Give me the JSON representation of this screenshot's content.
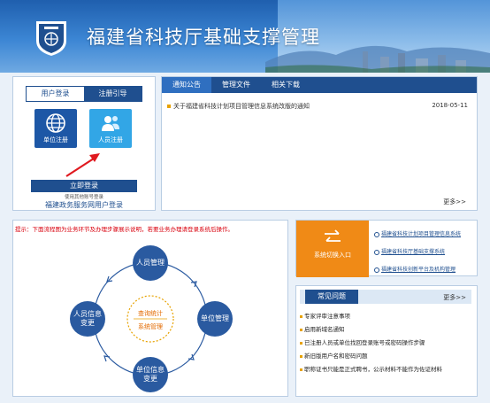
{
  "header": {
    "title": "福建省科技厅基础支撑管理"
  },
  "login": {
    "tabs": [
      "用户登录",
      "注册引导"
    ],
    "unit_register": "单位注册",
    "person_register": "人员注册",
    "login_button": "立即登录",
    "note": "使用其他账号登录",
    "gov_link": "福建政务服务网用户登录"
  },
  "notice": {
    "tabs": [
      "通知公告",
      "管理文件",
      "相关下载"
    ],
    "items": [
      {
        "title": "关于福建省科技计划项目管理信息系统改版的通知",
        "date": "2018-05-11"
      }
    ],
    "more": "更多>>"
  },
  "process": {
    "hint": "提示：下面流程图为业务环节及办理步骤展示说明，若要业务办理请登录系统后操作。",
    "nodes": {
      "top": "人员管理",
      "right": "单位管理",
      "bottom": "单位信息变更",
      "left": "人员信息变更"
    },
    "center": [
      "查询统计",
      "系统管理"
    ]
  },
  "switch": {
    "label": "系统切换入口",
    "links": [
      "福建省科技计划项目管理信息系统",
      "福建省科技厅基础支撑系统",
      "福建省科技创新平台及机构管理"
    ]
  },
  "faq": {
    "title": "常见问题",
    "more": "更多>>",
    "items": [
      "专家评审注意事项",
      "启用新域名通知",
      "已注册人员或单位找回登录账号或密码操作步骤",
      "新旧版用户名和密码问题",
      "职称证书只能是正式聘书，公示材料不能作为佐证材料"
    ]
  },
  "colors": {
    "primary": "#1f4f8f",
    "accent_orange": "#f08a16",
    "hint_red": "#d9000d"
  }
}
